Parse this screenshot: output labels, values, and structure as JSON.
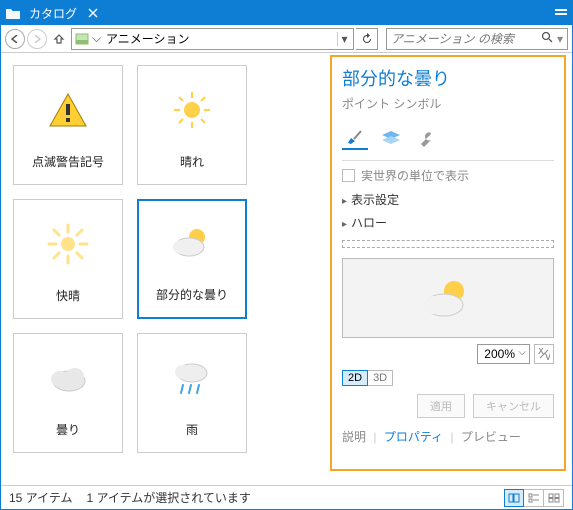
{
  "titlebar": {
    "title": "カタログ"
  },
  "toolbar": {
    "breadcrumb": "アニメーション",
    "search_placeholder": "アニメーション の検索"
  },
  "items": [
    {
      "label": "点滅警告記号"
    },
    {
      "label": "晴れ"
    },
    {
      "label": "快晴"
    },
    {
      "label": "部分的な曇り"
    },
    {
      "label": "曇り"
    },
    {
      "label": "雨"
    }
  ],
  "panel": {
    "title": "部分的な曇り",
    "subtitle": "ポイント シンボル",
    "checkbox_label": "実世界の単位で表示",
    "expanders": [
      "表示設定",
      "ハロー"
    ],
    "zoom": "200%",
    "dims": [
      "2D",
      "3D"
    ],
    "buttons": {
      "apply": "適用",
      "cancel": "キャンセル"
    },
    "tabs": {
      "desc": "説明",
      "props": "プロパティ",
      "preview": "プレビュー"
    }
  },
  "status": {
    "count": "15 アイテム",
    "selection": "1 アイテムが選択されています"
  }
}
